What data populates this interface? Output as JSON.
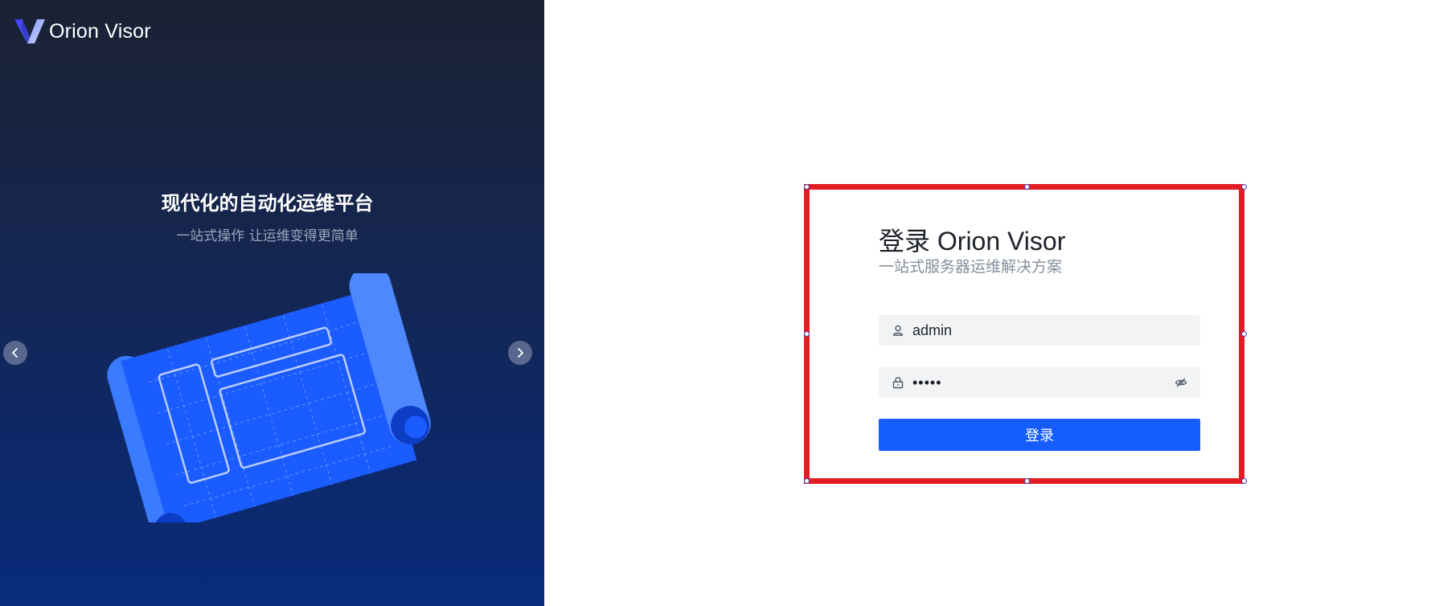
{
  "brand": {
    "name": "Orion Visor",
    "logo_icon": "orion-visor-logo-icon"
  },
  "banner": {
    "title": "现代化的自动化运维平台",
    "subtitle": "一站式操作 让运维变得更简单",
    "illustration": "blueprint-scroll-illustration",
    "prev_icon": "chevron-left-icon",
    "next_icon": "chevron-right-icon"
  },
  "login": {
    "title": "登录 Orion Visor",
    "subtitle": "一站式服务器运维解决方案",
    "username": {
      "value": "admin",
      "icon": "user-icon"
    },
    "password": {
      "value": "•••••",
      "icon": "lock-icon",
      "toggle_icon": "eye-hidden-icon"
    },
    "submit_label": "登录"
  },
  "colors": {
    "banner_top": "#1b2234",
    "banner_bottom": "#082b7c",
    "primary": "#165dff",
    "selection_border": "#e51c23",
    "input_bg": "#f2f3f5",
    "subtitle_text": "#86909c"
  }
}
